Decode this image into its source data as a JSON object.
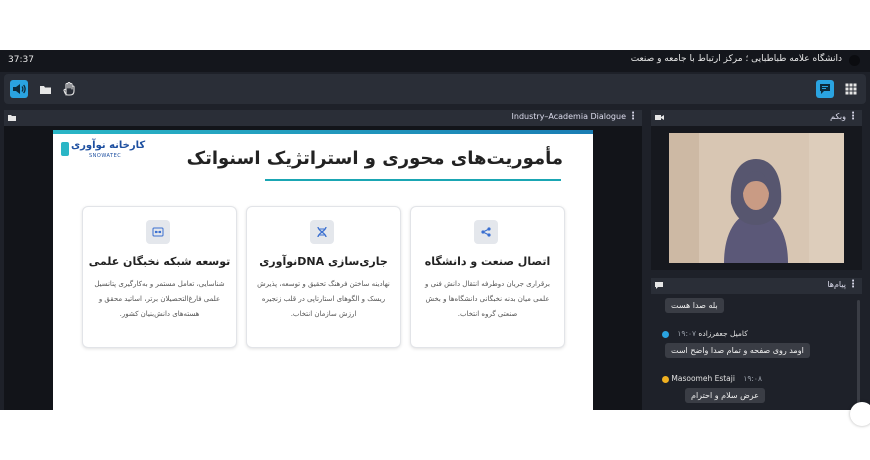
{
  "window": {
    "title": "دانشگاه علامه طباطبایی ؛ مرکز ارتباط با جامعه و صنعت",
    "clock": "37:37"
  },
  "toolbar": {
    "left_icons": [
      "speaker-icon",
      "folder-icon",
      "hand-icon"
    ],
    "right_icons": [
      "chat-icon",
      "grid-icon"
    ],
    "accent": "#2aa3e0"
  },
  "presentation": {
    "panel_title": "Industry–Academia Dialogue",
    "slide": {
      "logo_text": "کارخانه نوآوری",
      "logo_sub": "SNOWATEC",
      "title": "مأموریت‌های محوری و استراتژیک اسنواتک",
      "cards": [
        {
          "icon": "link-icon",
          "title": "اتصال صنعت و دانشگاه",
          "body": "برقراری جریان دوطرفه انتقال دانش فنی و علمی میان بدنه نخبگانی دانشگاه‌ها و بخش صنعتی گروه انتخاب."
        },
        {
          "icon": "dna-icon",
          "title": "جاری‌سازی DNAنوآوری",
          "body": "نهادینه ساختن فرهنگ تحقیق و توسعه، پذیرش ریسک و الگوهای استارتاپی در قلب زنجیره ارزش سازمان انتخاب."
        },
        {
          "icon": "network-icon",
          "title": "توسعه شبکه نخبگان علمی",
          "body": "شناسایی، تعامل مستمر و به‌کارگیری پتانسیل علمی فارغ‌التحصیلان برتر، اساتید محقق و هسته‌های دانش‌بنیان کشور."
        }
      ]
    }
  },
  "webcam": {
    "panel_title": "وبکم"
  },
  "chat": {
    "panel_title": "پیام‌ها",
    "messages": [
      {
        "author": "",
        "time": "",
        "text": "بله صدا هست",
        "avatar_color": ""
      },
      {
        "author": "کامیل جعفرزاده",
        "time": "۱۹:۰۷",
        "text": "اومد روی صفحه و تمام صدا واضح است",
        "avatar_color": "#2aa3e0"
      },
      {
        "author": "Masoomeh Estaji",
        "time": "۱۹:۰۸",
        "text": "عرض سلام و احترام",
        "avatar_color": "#f0b020"
      }
    ]
  }
}
